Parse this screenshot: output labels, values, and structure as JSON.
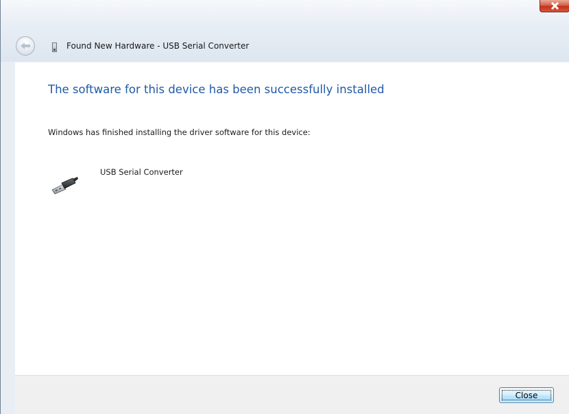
{
  "window": {
    "title": "Found New Hardware - USB Serial Converter"
  },
  "content": {
    "heading": "The software for this device has been successfully installed",
    "message": "Windows has finished installing the driver software for this device:",
    "device_name": "USB Serial Converter"
  },
  "footer": {
    "close_label": "Close"
  },
  "icons": {
    "window_close": "close-icon",
    "back": "back-arrow-icon",
    "title": "hardware-icon",
    "device": "usb-connector-icon"
  },
  "colors": {
    "heading": "#1f5aa6",
    "close_button_border": "#3c7fb1",
    "window_close": "#c2321b"
  }
}
